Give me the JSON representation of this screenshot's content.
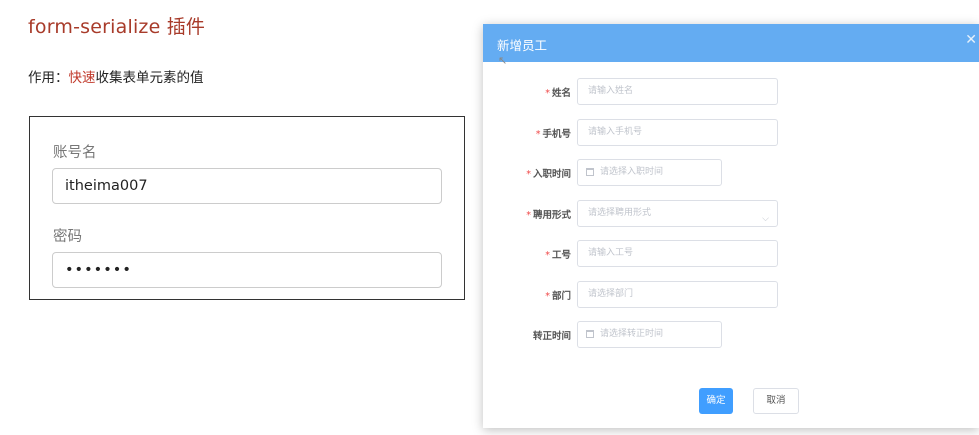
{
  "slide": {
    "title": "form-serialize 插件",
    "desc_prefix": "作用：",
    "desc_highlight": "快速",
    "desc_suffix": "收集表单元素的值"
  },
  "demo_form": {
    "account_label": "账号名",
    "account_value": "itheima007",
    "password_label": "密码",
    "password_value": "•••••••"
  },
  "dialog": {
    "title": "新增员工",
    "close_icon": "close-icon",
    "fields": [
      {
        "label": "姓名",
        "required": "*",
        "placeholder": "请输入姓名"
      },
      {
        "label": "手机号",
        "required": "*",
        "placeholder": "请输入手机号"
      },
      {
        "label": "入职时间",
        "required": "*",
        "placeholder": "请选择入职时间"
      },
      {
        "label": "聘用形式",
        "required": "*",
        "placeholder": "请选择聘用形式"
      },
      {
        "label": "工号",
        "required": "*",
        "placeholder": "请输入工号"
      },
      {
        "label": "部门",
        "required": "*",
        "placeholder": "请选择部门"
      },
      {
        "label": "转正时间",
        "required": "",
        "placeholder": "请选择转正时间"
      }
    ],
    "confirm_label": "确定",
    "cancel_label": "取消"
  },
  "colors": {
    "title_red": "#a83b2a",
    "highlight_red": "#c0392b",
    "dialog_header": "#64acf2",
    "primary_button": "#409eff"
  }
}
